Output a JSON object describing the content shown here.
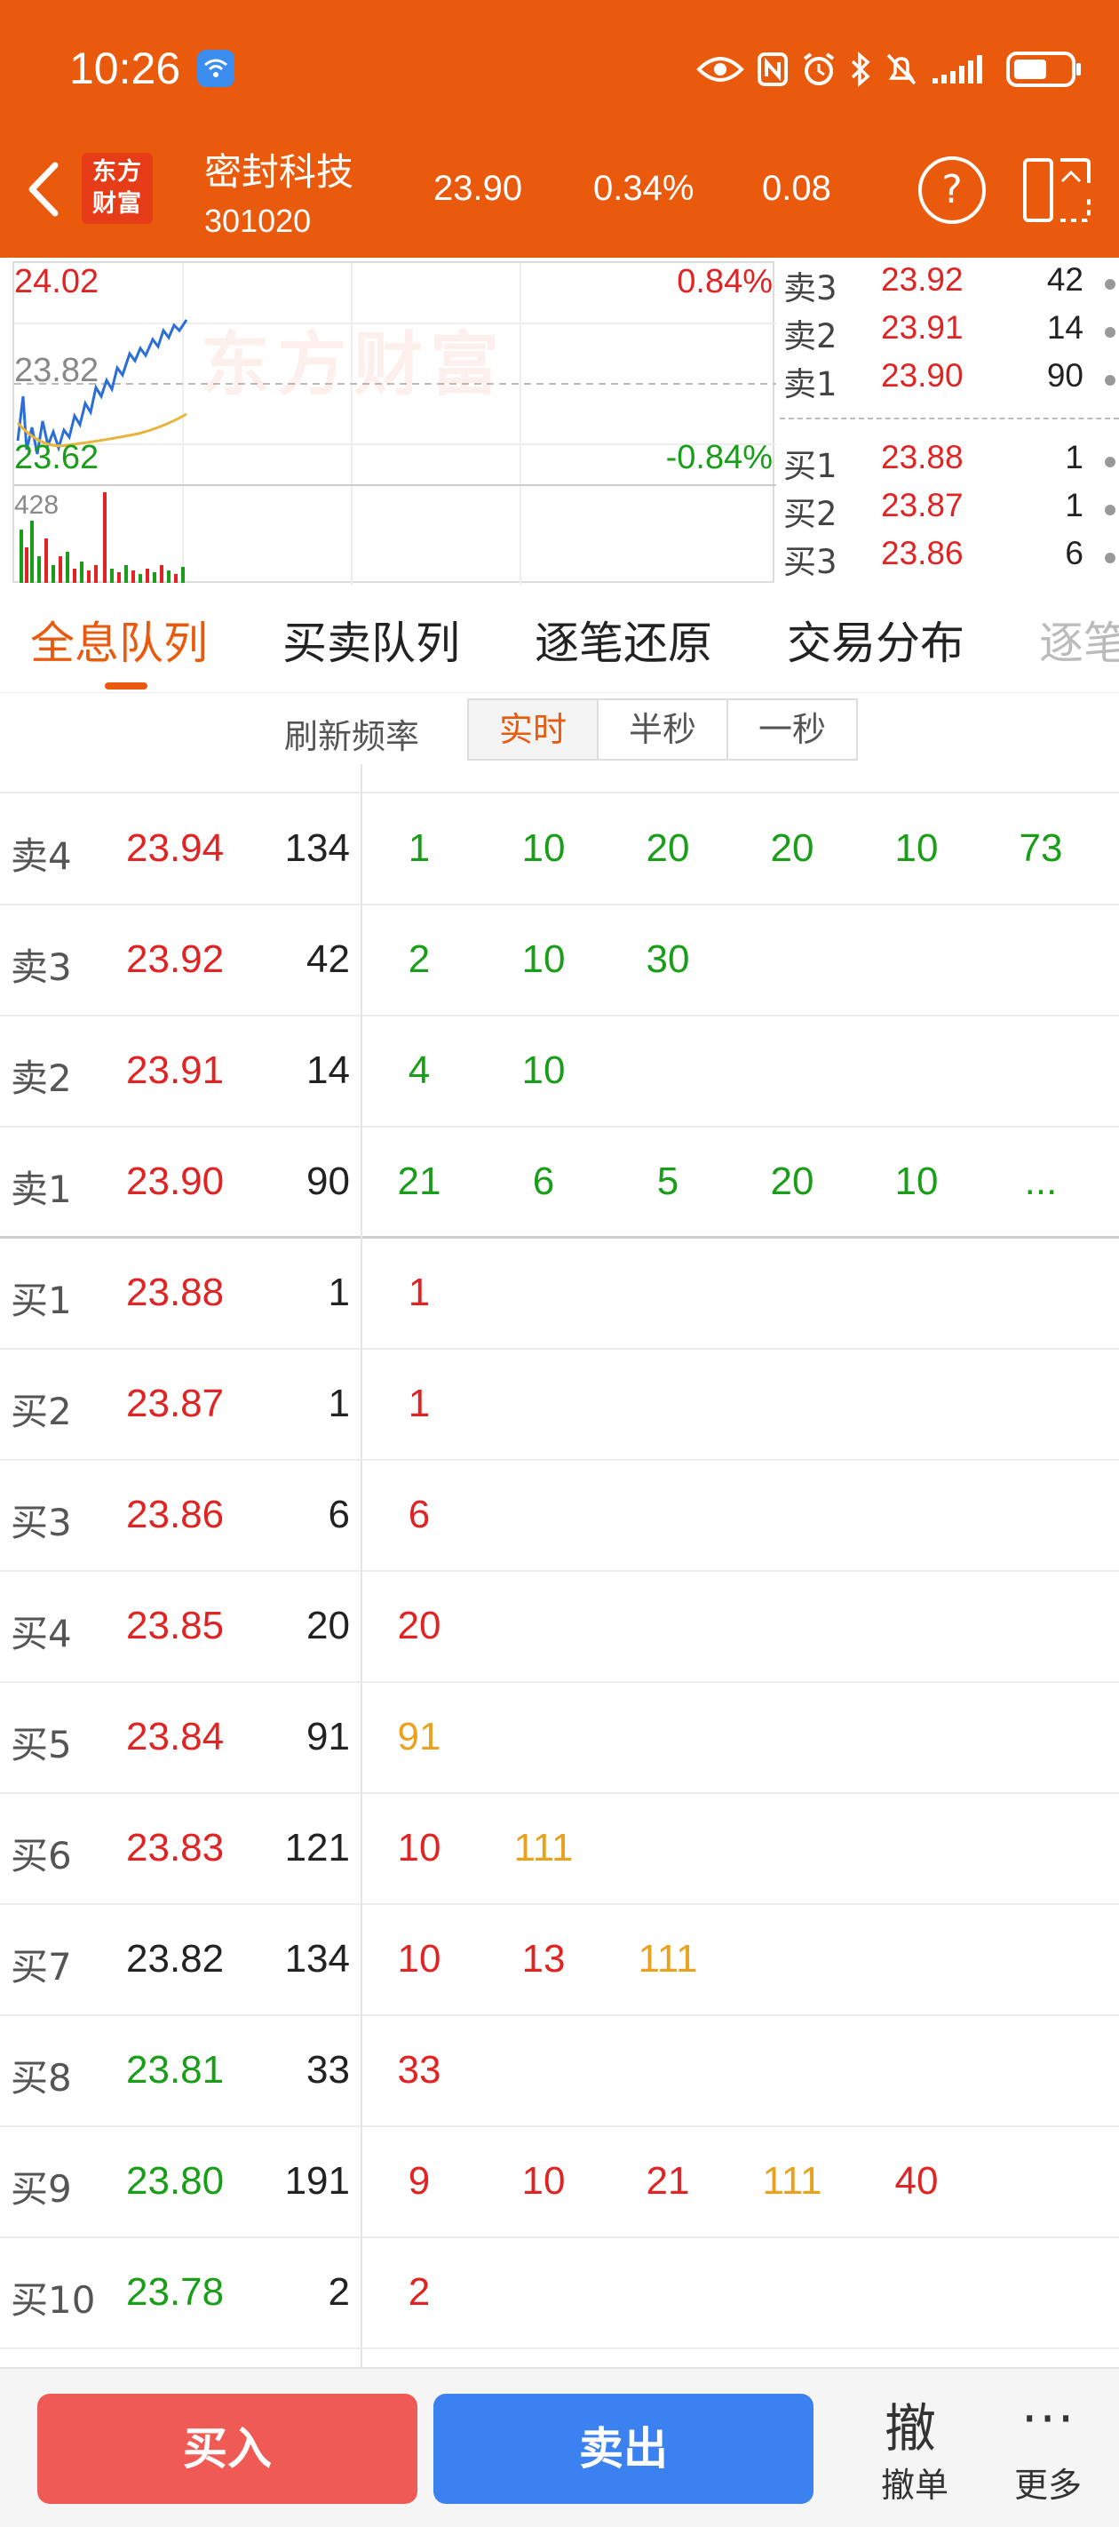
{
  "status": {
    "time": "10:26"
  },
  "header": {
    "logo_text_line1": "东方",
    "logo_text_line2": "财富",
    "stock_name": "密封科技",
    "stock_code": "301020",
    "price": "23.90",
    "change_pct": "0.34%",
    "change": "0.08",
    "help_label": "?"
  },
  "chart": {
    "price_high": "24.02",
    "price_mid": "23.82",
    "price_low": "23.62",
    "pct_high": "0.84%",
    "pct_low": "-0.84%",
    "volume_label": "428",
    "watermark": "东方财富"
  },
  "orderbook": {
    "asks": [
      {
        "label": "卖3",
        "price": "23.92",
        "vol": "42"
      },
      {
        "label": "卖2",
        "price": "23.91",
        "vol": "14"
      },
      {
        "label": "卖1",
        "price": "23.90",
        "vol": "90"
      }
    ],
    "bids": [
      {
        "label": "买1",
        "price": "23.88",
        "vol": "1"
      },
      {
        "label": "买2",
        "price": "23.87",
        "vol": "1"
      },
      {
        "label": "买3",
        "price": "23.86",
        "vol": "6"
      }
    ]
  },
  "tabs": [
    {
      "label": "全息队列"
    },
    {
      "label": "买卖队列"
    },
    {
      "label": "逐笔还原"
    },
    {
      "label": "交易分布"
    },
    {
      "label": "逐笔"
    }
  ],
  "refresh": {
    "label": "刷新频率",
    "options": [
      "实时",
      "半秒",
      "一秒"
    ]
  },
  "queue": {
    "rows": [
      {
        "label": "卖4",
        "price": "23.94",
        "vol": "134",
        "q": [
          "1",
          "10",
          "20",
          "20",
          "10",
          "73"
        ]
      },
      {
        "label": "卖3",
        "price": "23.92",
        "vol": "42",
        "q": [
          "2",
          "10",
          "30"
        ]
      },
      {
        "label": "卖2",
        "price": "23.91",
        "vol": "14",
        "q": [
          "4",
          "10"
        ]
      },
      {
        "label": "卖1",
        "price": "23.90",
        "vol": "90",
        "q": [
          "21",
          "6",
          "5",
          "20",
          "10",
          "..."
        ]
      },
      {
        "label": "买1",
        "price": "23.88",
        "vol": "1",
        "q": [
          "1"
        ]
      },
      {
        "label": "买2",
        "price": "23.87",
        "vol": "1",
        "q": [
          "1"
        ]
      },
      {
        "label": "买3",
        "price": "23.86",
        "vol": "6",
        "q": [
          "6"
        ]
      },
      {
        "label": "买4",
        "price": "23.85",
        "vol": "20",
        "q": [
          "20"
        ]
      },
      {
        "label": "买5",
        "price": "23.84",
        "vol": "91",
        "q": [
          "91"
        ]
      },
      {
        "label": "买6",
        "price": "23.83",
        "vol": "121",
        "q": [
          "10",
          "111"
        ]
      },
      {
        "label": "买7",
        "price": "23.82",
        "vol": "134",
        "q": [
          "10",
          "13",
          "111"
        ]
      },
      {
        "label": "买8",
        "price": "23.81",
        "vol": "33",
        "q": [
          "33"
        ]
      },
      {
        "label": "买9",
        "price": "23.80",
        "vol": "191",
        "q": [
          "9",
          "10",
          "21",
          "111",
          "40"
        ]
      },
      {
        "label": "买10",
        "price": "23.78",
        "vol": "2",
        "q": [
          "2"
        ]
      }
    ]
  },
  "bottom": {
    "buy_label": "买入",
    "sell_label": "卖出",
    "cancel_glyph": "撤",
    "cancel_label": "撤单",
    "more_label": "更多"
  },
  "colors": {
    "brand_orange": "#ea5a0c",
    "up_red": "#e02424",
    "down_green": "#1a9e1a",
    "large_order_orange": "#e9a21f",
    "buy_button": "#f05a55",
    "sell_button": "#3b82f0"
  }
}
